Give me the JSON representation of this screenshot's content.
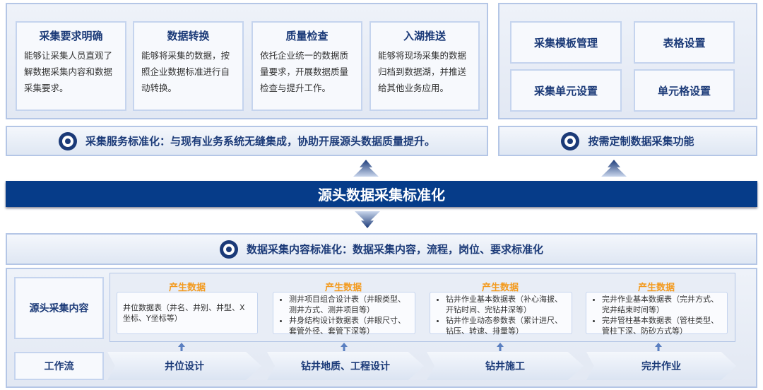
{
  "top_cards": [
    {
      "title": "采集要求明确",
      "text": "能够让采集人员直观了解数据采集内容和数据采集要求。"
    },
    {
      "title": "数据转换",
      "text": "能够将采集的数据，按照企业数据标准进行自动转换。"
    },
    {
      "title": "质量检查",
      "text": "依托企业统一的数据质量要求，开展数据质量检查与提升工作。"
    },
    {
      "title": "入湖推送",
      "text": "能够将现场采集的数据归档到数据湖，并推送给其他业务应用。"
    }
  ],
  "right_buttons": [
    "采集模板管理",
    "表格设置",
    "采集单元设置",
    "单元格设置"
  ],
  "service_bar": "采集服务标准化：与现有业务系统无缝集成，协助开展源头数据质量提升。",
  "custom_bar": "按需定制数据采集功能",
  "main_band": "源头数据采集标准化",
  "content_bar": "数据采集内容标准化：数据采集内容，流程，岗位、要求标准化",
  "source_label": "源头采集内容",
  "workflow_label": "工作流",
  "data_heading": "产生数据",
  "data_cards": [
    {
      "plain": "井位数据表（井名、井别、井型、X坐标、Y坐标等）"
    },
    {
      "items": [
        "测井项目组合设计表（井眼类型、测井方式、测井项目等）",
        "井身结构设计数据表（井眼尺寸、套管外径、套管下深等）"
      ]
    },
    {
      "items": [
        "钻井作业基本数据表（补心海拔、开钻时间、完钻井深等）",
        "钻井作业动态参数表（累计进尺、钻压、转速、排量等）"
      ]
    },
    {
      "items": [
        "完井作业基本数据表（完井方式、完井结束时间等）",
        "完井管柱基本数据表（管柱类型、管柱下深、防砂方式等）"
      ]
    }
  ],
  "workflow": [
    "井位设计",
    "钻井地质、工程设计",
    "钻井施工",
    "完井作业"
  ]
}
